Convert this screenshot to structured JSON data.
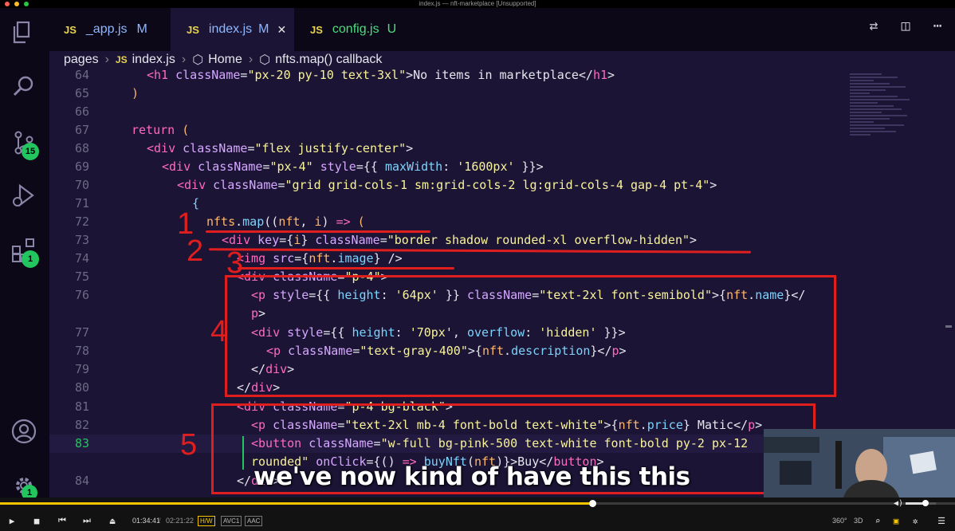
{
  "window": {
    "title": "index.js — nft-marketplace [Unsupported]"
  },
  "tabs": [
    {
      "icon": "JS",
      "label": "_app.js",
      "status": "M",
      "status_color": "#8fb8ff"
    },
    {
      "icon": "JS",
      "label": "index.js",
      "status": "M",
      "status_color": "#8fb8ff",
      "close": "✕"
    },
    {
      "icon": "JS",
      "label": "config.js",
      "status": "U",
      "status_color": "#4ade80"
    }
  ],
  "breadcrumb": {
    "folder": "pages",
    "file_icon": "JS",
    "file": "index.js",
    "symbol1": "Home",
    "symbol2": "nfts.map() callback"
  },
  "activity": {
    "scm_badge": "15",
    "ext_badge": "1",
    "settings_badge": "1"
  },
  "annotations": {
    "n1": "1",
    "n2": "2",
    "n3": "3",
    "n4": "4",
    "n5": "5"
  },
  "subtitle": "we've now kind of have this this",
  "player": {
    "elapsed": "01:34:41",
    "total": "02:21:22",
    "badges": [
      "H/W",
      "AVC1",
      "AAC"
    ],
    "right_labels": [
      "360°",
      "3D"
    ],
    "progress": 0.62,
    "volume": 0.65
  },
  "colors": {
    "accent": "#f5c400",
    "annotation": "#e01e1e",
    "badge": "#22c55e"
  }
}
